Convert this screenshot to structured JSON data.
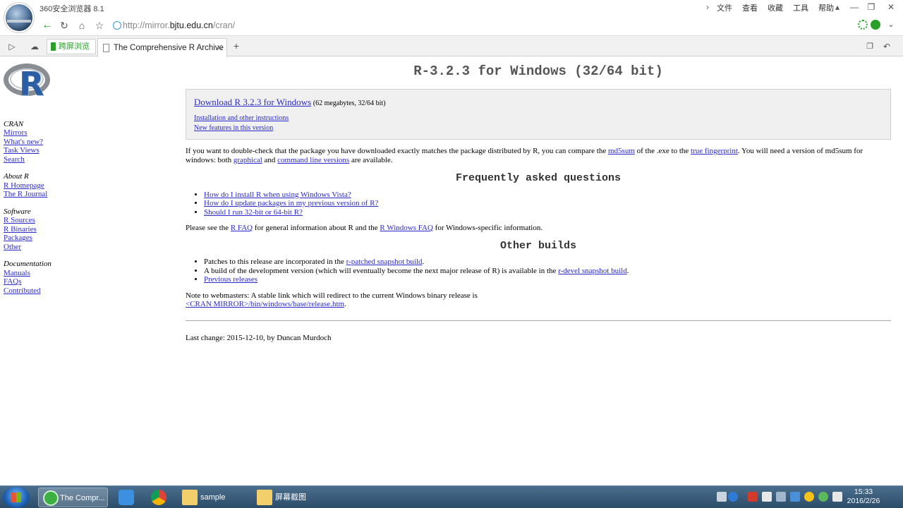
{
  "browser": {
    "title": "360安全浏览器 8.1",
    "menu": [
      "文件",
      "查看",
      "收藏",
      "工具",
      "帮助"
    ],
    "url_prefix": "http://mirror.",
    "url_host": "bjtu.edu.cn",
    "url_path": "/cran/",
    "tabs": {
      "cross_screen": "跨屏浏览",
      "active": "The Comprehensive R Archive",
      "new_tab": "+"
    }
  },
  "sidebar": {
    "cran": {
      "heading": "CRAN",
      "links": [
        "Mirrors",
        "What's new?",
        "Task Views",
        "Search"
      ]
    },
    "about": {
      "heading": "About R",
      "links": [
        "R Homepage",
        "The R Journal"
      ]
    },
    "software": {
      "heading": "Software",
      "links": [
        "R Sources",
        "R Binaries",
        "Packages",
        "Other"
      ]
    },
    "documentation": {
      "heading": "Documentation",
      "links": [
        "Manuals",
        "FAQs",
        "Contributed"
      ]
    }
  },
  "page": {
    "title": "R-3.2.3 for Windows (32/64 bit)",
    "download": {
      "link": "Download R 3.2.3 for Windows",
      "note": "(62 megabytes, 32/64 bit)",
      "install_link": "Installation and other instructions",
      "features_link": "New features in this version"
    },
    "check": {
      "t1": "If you want to double-check that the package you have downloaded exactly matches the package distributed by R, you can compare the ",
      "md5": "md5sum",
      "t2": " of the .exe to the ",
      "fingerprint": "true fingerprint",
      "t3": ". You will need a version of md5sum for windows: both ",
      "graphical": "graphical",
      "t4": " and ",
      "cmdline": "command line versions",
      "t5": " are available."
    },
    "faq": {
      "heading": "Frequently asked questions",
      "items": [
        "How do I install R when using Windows Vista?",
        "How do I update packages in my previous version of R?",
        "Should I run 32-bit or 64-bit R?"
      ],
      "see_t1": "Please see the ",
      "rfaq": "R FAQ",
      "see_t2": " for general information about R and the ",
      "rwinfaq": "R Windows FAQ",
      "see_t3": " for Windows-specific information."
    },
    "other": {
      "heading": "Other builds",
      "i1_text": "Patches to this release are incorporated in the ",
      "i1_link": "r-patched snapshot build",
      "i2_text": "A build of the development version (which will eventually become the next major release of R) is available in the ",
      "i2_link": "r-devel snapshot build",
      "i3_link": "Previous releases"
    },
    "webmasters": {
      "text": "Note to webmasters: A stable link which will redirect to the current Windows binary release is",
      "link": "<CRAN MIRROR>/bin/windows/base/release.htm"
    },
    "last_change": "Last change: 2015-12-10, by Duncan Murdoch"
  },
  "taskbar": {
    "items": [
      "The Compr...",
      "sample",
      "屏幕截图"
    ],
    "time": "15:33",
    "date": "2016/2/26"
  }
}
